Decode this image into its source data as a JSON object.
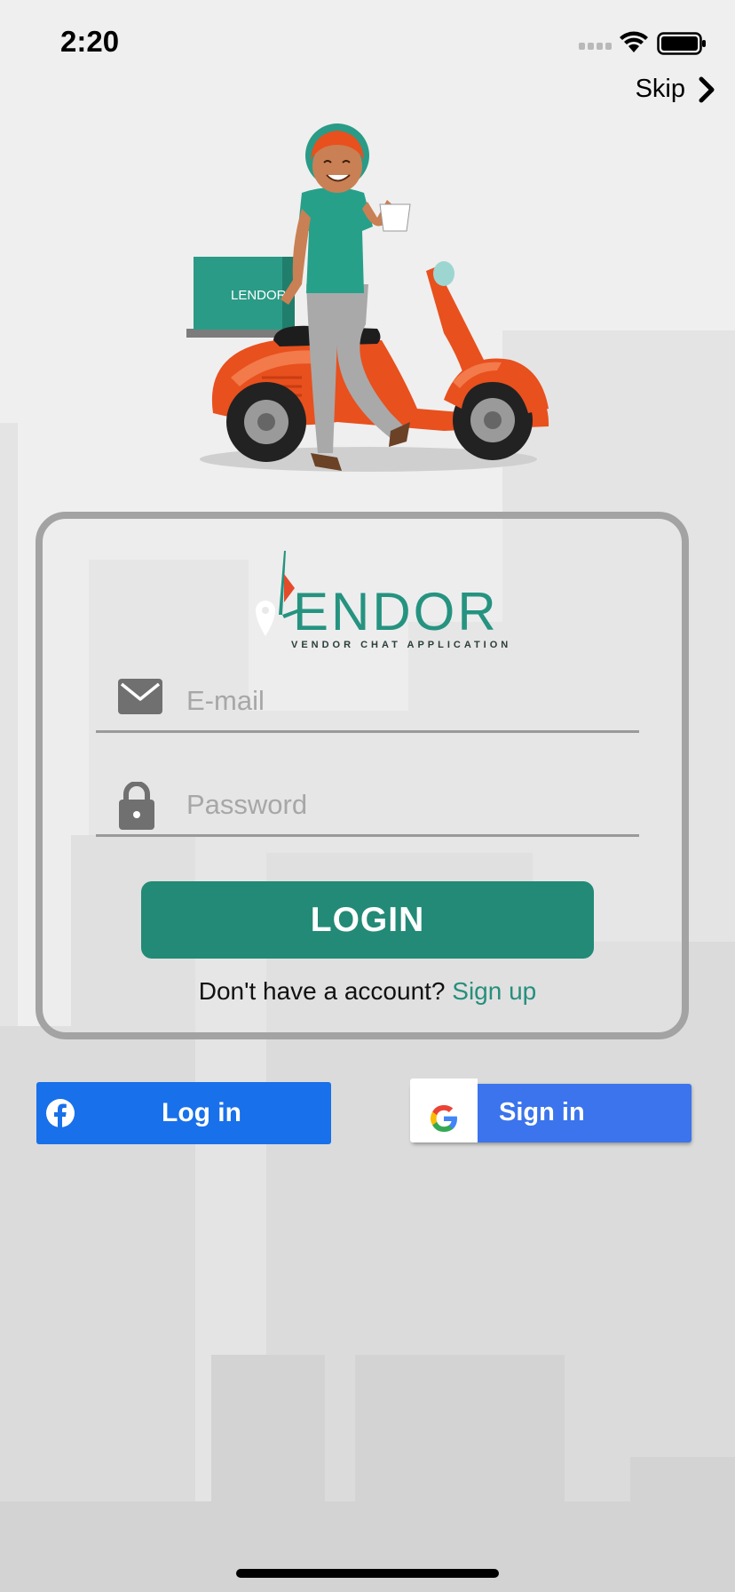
{
  "status_bar": {
    "time": "2:20"
  },
  "header": {
    "skip_label": "Skip"
  },
  "brand": {
    "logo_text": "ENDOR",
    "tagline": "VENDOR CHAT APPLICATION",
    "box_label": "LENDOR"
  },
  "form": {
    "email_placeholder": "E-mail",
    "password_placeholder": "Password",
    "login_label": "LOGIN",
    "signup_prompt": "Don't have a account?",
    "signup_link": "Sign up"
  },
  "social": {
    "facebook_label": "Log in",
    "google_label": "Sign in"
  },
  "icons": {
    "skip": "chevron-right-icon",
    "email": "mail-icon",
    "password": "lock-icon",
    "facebook": "facebook-icon",
    "google": "google-icon"
  },
  "colors": {
    "accent": "#228a76",
    "link": "#268f7d",
    "facebook": "#1870ea",
    "google": "#3b74ec",
    "scooter": "#e8501e"
  }
}
